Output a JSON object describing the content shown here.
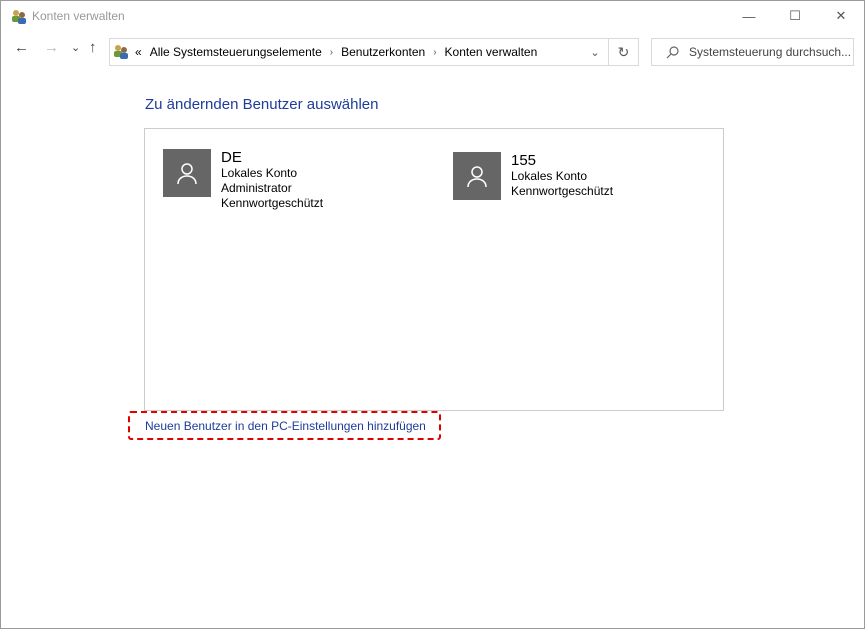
{
  "window": {
    "title": "Konten verwalten",
    "icon": "user-accounts-icon"
  },
  "controls": {
    "minimize": "—",
    "maximize": "☐",
    "close": "✕"
  },
  "nav": {
    "back": "←",
    "forward": "→",
    "recent": "⌄",
    "up": "↑"
  },
  "address": {
    "overflow": "«",
    "crumbs": [
      "Alle Systemsteuerungselemente",
      "Benutzerkonten",
      "Konten verwalten"
    ],
    "refresh": "↻"
  },
  "search": {
    "placeholder": "Systemsteuerung durchsuch..."
  },
  "main": {
    "heading": "Zu ändernden Benutzer auswählen",
    "accounts": [
      {
        "name": "DE",
        "lines": [
          "Lokales Konto",
          "Administrator",
          "Kennwortgeschützt"
        ]
      },
      {
        "name": "155",
        "lines": [
          "Lokales Konto",
          "Kennwortgeschützt"
        ]
      }
    ],
    "add_user_link": "Neuen Benutzer in den PC-Einstellungen hinzufügen"
  },
  "colors": {
    "link": "#1e3c9a",
    "highlight": "#e00000",
    "avatar": "#666666"
  }
}
